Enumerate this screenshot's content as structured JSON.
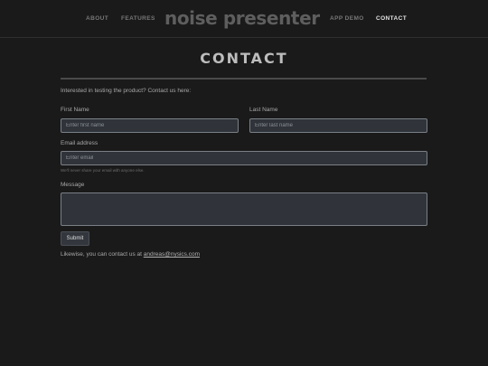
{
  "nav": {
    "about": "ABOUT",
    "features": "FEATURES",
    "brand": "noise presenter",
    "app_demo": "APP DEMO",
    "contact": "CONTACT"
  },
  "page": {
    "title": "CONTACT",
    "intro": "Interested in testing the product? Contact us here:"
  },
  "form": {
    "first_name_label": "First Name",
    "first_name_placeholder": "Enter first name",
    "first_name_value": "",
    "last_name_label": "Last Name",
    "last_name_placeholder": "Enter last name",
    "last_name_value": "",
    "email_label": "Email address",
    "email_placeholder": "Enter email",
    "email_value": "",
    "email_help": "We'll never share your email with anyone else.",
    "message_label": "Message",
    "message_value": "",
    "submit_label": "Submit"
  },
  "footer_contact": {
    "prefix": "Likewise, you can contact us at ",
    "email": "andreas@nysics.com"
  },
  "colors": {
    "background": "#1a1a1a",
    "field_background": "#30343a",
    "field_border": "#7a7f86",
    "nav_active": "#e4e4e4",
    "nav_inactive": "#777777"
  }
}
